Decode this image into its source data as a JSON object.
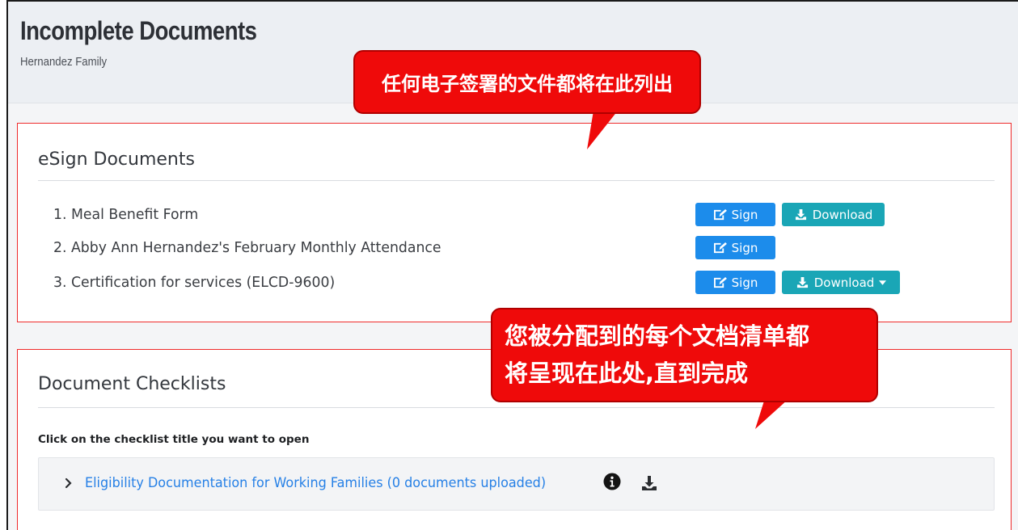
{
  "header": {
    "title": "Incomplete Documents",
    "subtitle": "Hernandez Family"
  },
  "esign": {
    "title": "eSign Documents",
    "documents": [
      {
        "name": "1. Meal Benefit Form",
        "sign_label": "Sign",
        "download_label": "Download"
      },
      {
        "name": "2. Abby Ann Hernandez's February Monthly Attendance",
        "sign_label": "Sign"
      },
      {
        "name": "3. Certification for services (ELCD-9600)",
        "sign_label": "Sign",
        "download_label": "Download"
      }
    ]
  },
  "checklists": {
    "title": "Document Checklists",
    "instruction": "Click on the checklist title you want to open",
    "items": [
      {
        "label": "Eligibility Documentation for Working Families (0 documents uploaded)"
      }
    ]
  },
  "callouts": [
    {
      "text": "任何电子签署的文件都将在此列出"
    },
    {
      "line1": "您被分配到的每个文档清单都",
      "line2": "将呈现在此处,直到完成"
    }
  ],
  "colors": {
    "sign_button": "#1c8ceb",
    "download_button": "#1aa6b6",
    "callout_red": "#ef0a0a",
    "highlight_border": "#ef2b2b",
    "link": "#2680e6"
  },
  "icons": [
    "sign-icon",
    "download-icon",
    "caret-down-icon",
    "chevron-right-icon",
    "info-icon"
  ]
}
